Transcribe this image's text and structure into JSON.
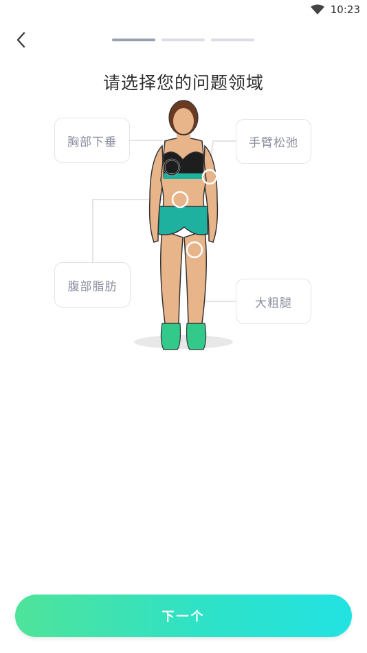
{
  "status_bar": {
    "time": "10:23"
  },
  "header": {
    "title": "请选择您的问题领域",
    "progress_steps": 3,
    "active_step": 1
  },
  "areas": {
    "chest": "胸部下垂",
    "arm": "手臂松弛",
    "belly": "腹部脂肪",
    "thigh": "大粗腿"
  },
  "footer": {
    "next_label": "下一个"
  },
  "colors": {
    "accent_start": "#4fe39a",
    "accent_end": "#22e2e2",
    "outfit": "#1fb1a0"
  }
}
